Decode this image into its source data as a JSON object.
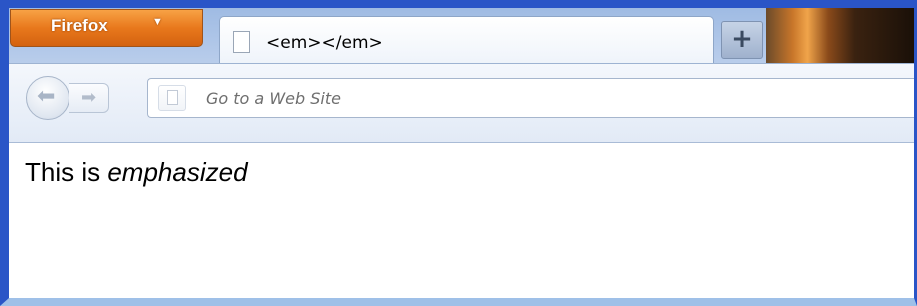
{
  "browser": {
    "menu_button_label": "Firefox",
    "menu_button_caret": "▼",
    "tab": {
      "title": "<em></em>",
      "icon": "page-icon"
    },
    "new_tab_label": "+",
    "nav": {
      "back_icon": "back-arrow-icon",
      "forward_icon": "forward-arrow-icon",
      "url_value": "",
      "url_placeholder": "Go to a Web Site"
    }
  },
  "page": {
    "text_plain": "This is ",
    "text_emphasized": "emphasized"
  },
  "colors": {
    "window_frame": "#2a55c7",
    "firefox_button": "#e8781c",
    "content_background": "#ffffff"
  }
}
